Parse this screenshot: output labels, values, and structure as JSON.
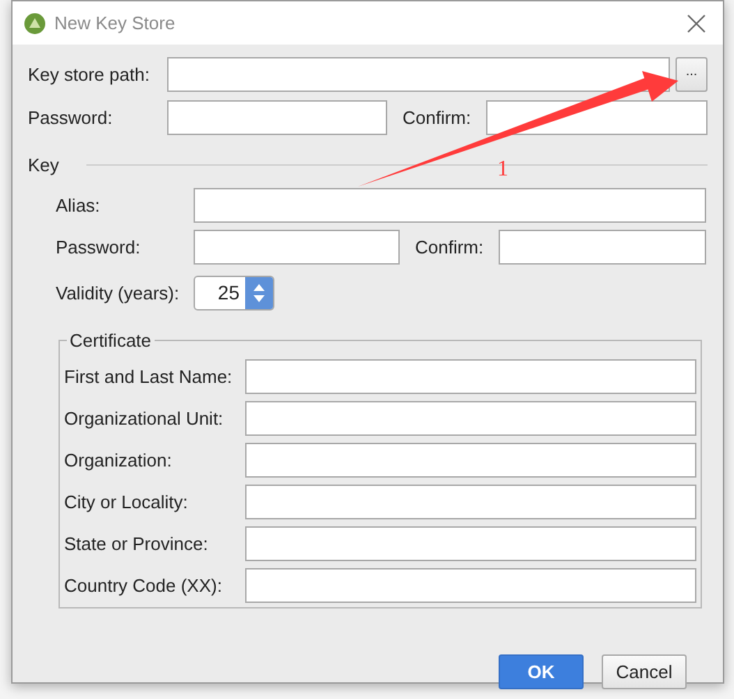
{
  "window": {
    "title": "New Key Store"
  },
  "keystore": {
    "path_label": "Key store path:",
    "browse": "...",
    "password_label": "Password:",
    "confirm_label": "Confirm:"
  },
  "key": {
    "section": "Key",
    "alias_label": "Alias:",
    "password_label": "Password:",
    "confirm_label": "Confirm:",
    "validity_label": "Validity (years):",
    "validity": "25"
  },
  "certificate": {
    "title": "Certificate",
    "fields": [
      {
        "label": "First and Last Name:"
      },
      {
        "label": "Organizational Unit:"
      },
      {
        "label": "Organization:"
      },
      {
        "label": "City or Locality:"
      },
      {
        "label": "State or Province:"
      },
      {
        "label": "Country Code (XX):"
      }
    ]
  },
  "buttons": [
    {
      "label": "OK",
      "kind": "primary"
    },
    {
      "label": "Cancel",
      "kind": "secondary"
    }
  ],
  "annotation": {
    "label": "1"
  }
}
